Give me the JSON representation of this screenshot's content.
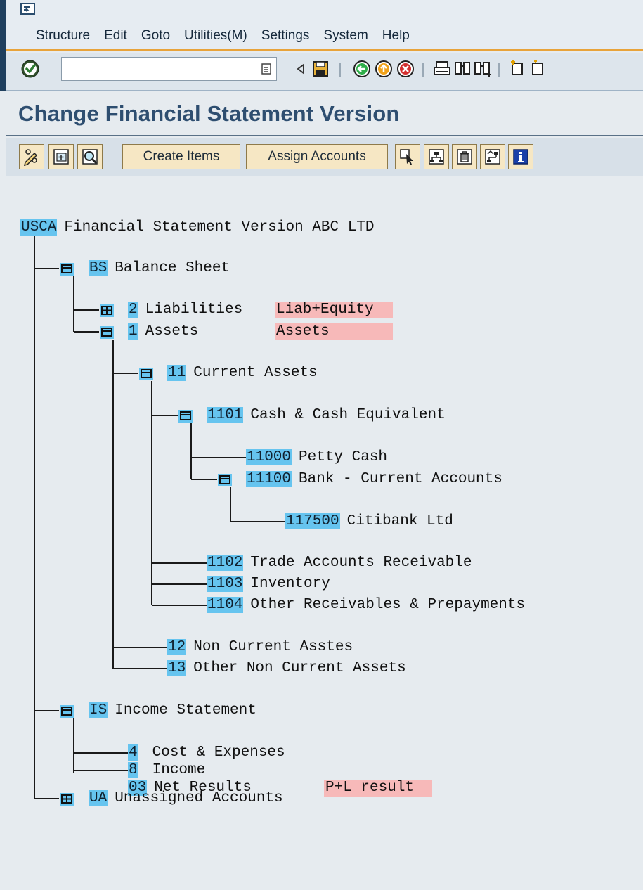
{
  "menu": {
    "items": [
      "Structure",
      "Edit",
      "Goto",
      "Utilities(M)",
      "Settings",
      "System",
      "Help"
    ]
  },
  "toolbar": {
    "command_field_value": ""
  },
  "page": {
    "title": "Change Financial Statement Version"
  },
  "app_toolbar": {
    "create_items_label": "Create Items",
    "assign_accounts_label": "Assign Accounts"
  },
  "tree": {
    "root": {
      "key": "USCA",
      "text": "Financial Statement Version ABC LTD"
    },
    "bs": {
      "key": "BS",
      "text": "Balance Sheet"
    },
    "liab": {
      "key": "2",
      "text": "Liabilities",
      "tag": "Liab+Equity"
    },
    "assets": {
      "key": "1",
      "text": "Assets",
      "tag": "Assets"
    },
    "current_assets": {
      "key": "11",
      "text": "Current Assets"
    },
    "cash": {
      "key": "1101",
      "text": "Cash & Cash Equivalent"
    },
    "petty": {
      "key": "11000",
      "text": "Petty Cash"
    },
    "bank": {
      "key": "11100",
      "text": "Bank - Current Accounts"
    },
    "citi": {
      "key": "117500",
      "text": "Citibank Ltd"
    },
    "trade": {
      "key": "1102",
      "text": "Trade Accounts Receivable"
    },
    "inv": {
      "key": "1103",
      "text": "Inventory"
    },
    "other_rec": {
      "key": "1104",
      "text": "Other Receivables & Prepayments"
    },
    "noncur": {
      "key": "12",
      "text": "Non Current Asstes"
    },
    "other_noncur": {
      "key": "13",
      "text": "Other Non Current Assets"
    },
    "is": {
      "key": "IS",
      "text": "Income Statement"
    },
    "cost": {
      "key": "4",
      "text": "Cost & Expenses"
    },
    "income": {
      "key": "8",
      "text": "Income"
    },
    "net": {
      "key": "03",
      "text": "Net Results",
      "tag": "P+L result"
    },
    "ua": {
      "key": "UA",
      "text": "Unassigned Accounts"
    }
  },
  "colors": {
    "key_highlight": "#66c4ef",
    "tag_background": "#f7b9b9",
    "title_blue": "#2e4e70",
    "menu_accent": "#e8a33a"
  },
  "icons": {
    "toolbar": [
      "enter-icon",
      "back-icon",
      "save-icon",
      "back-green-icon",
      "exit-icon",
      "cancel-icon",
      "print-icon",
      "find-icon",
      "find-next-icon",
      "first-page-icon"
    ],
    "app_toolbar": [
      "change-display-icon",
      "expand-icon",
      "find-node-icon",
      "select-icon",
      "structure-icon",
      "delete-icon",
      "hierarchy-icon",
      "info-icon"
    ]
  }
}
